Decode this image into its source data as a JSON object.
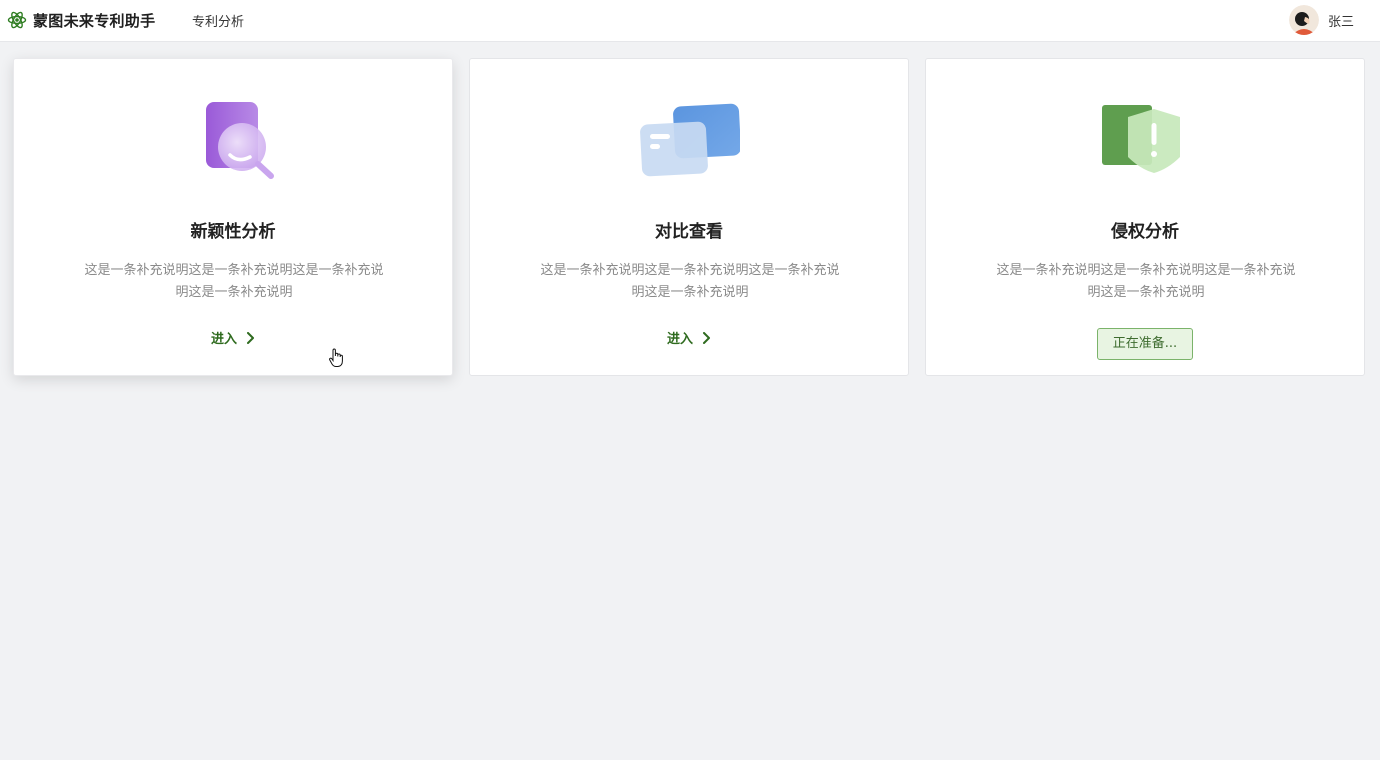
{
  "header": {
    "app_name": "蒙图未来专利助手",
    "nav_item": "专利分析",
    "user_name": "张三",
    "logo_icon": "atom-icon",
    "accent": "#2f6b1f"
  },
  "cards": [
    {
      "title": "新颖性分析",
      "description": "这是一条补充说明这是一条补充说明这是一条补充说明这是一条补充说明",
      "action_label": "进入",
      "icon": "search-document-icon",
      "icon_color": "#a86be0"
    },
    {
      "title": "对比查看",
      "description": "这是一条补充说明这是一条补充说明这是一条补充说明这是一条补充说明",
      "action_label": "进入",
      "icon": "compare-cards-icon",
      "icon_color": "#5f9ae0"
    },
    {
      "title": "侵权分析",
      "description": "这是一条补充说明这是一条补充说明这是一条补充说明这是一条补充说明",
      "action_label": "正在准备...",
      "icon": "shield-warning-icon",
      "icon_color": "#5a9e4b"
    }
  ]
}
